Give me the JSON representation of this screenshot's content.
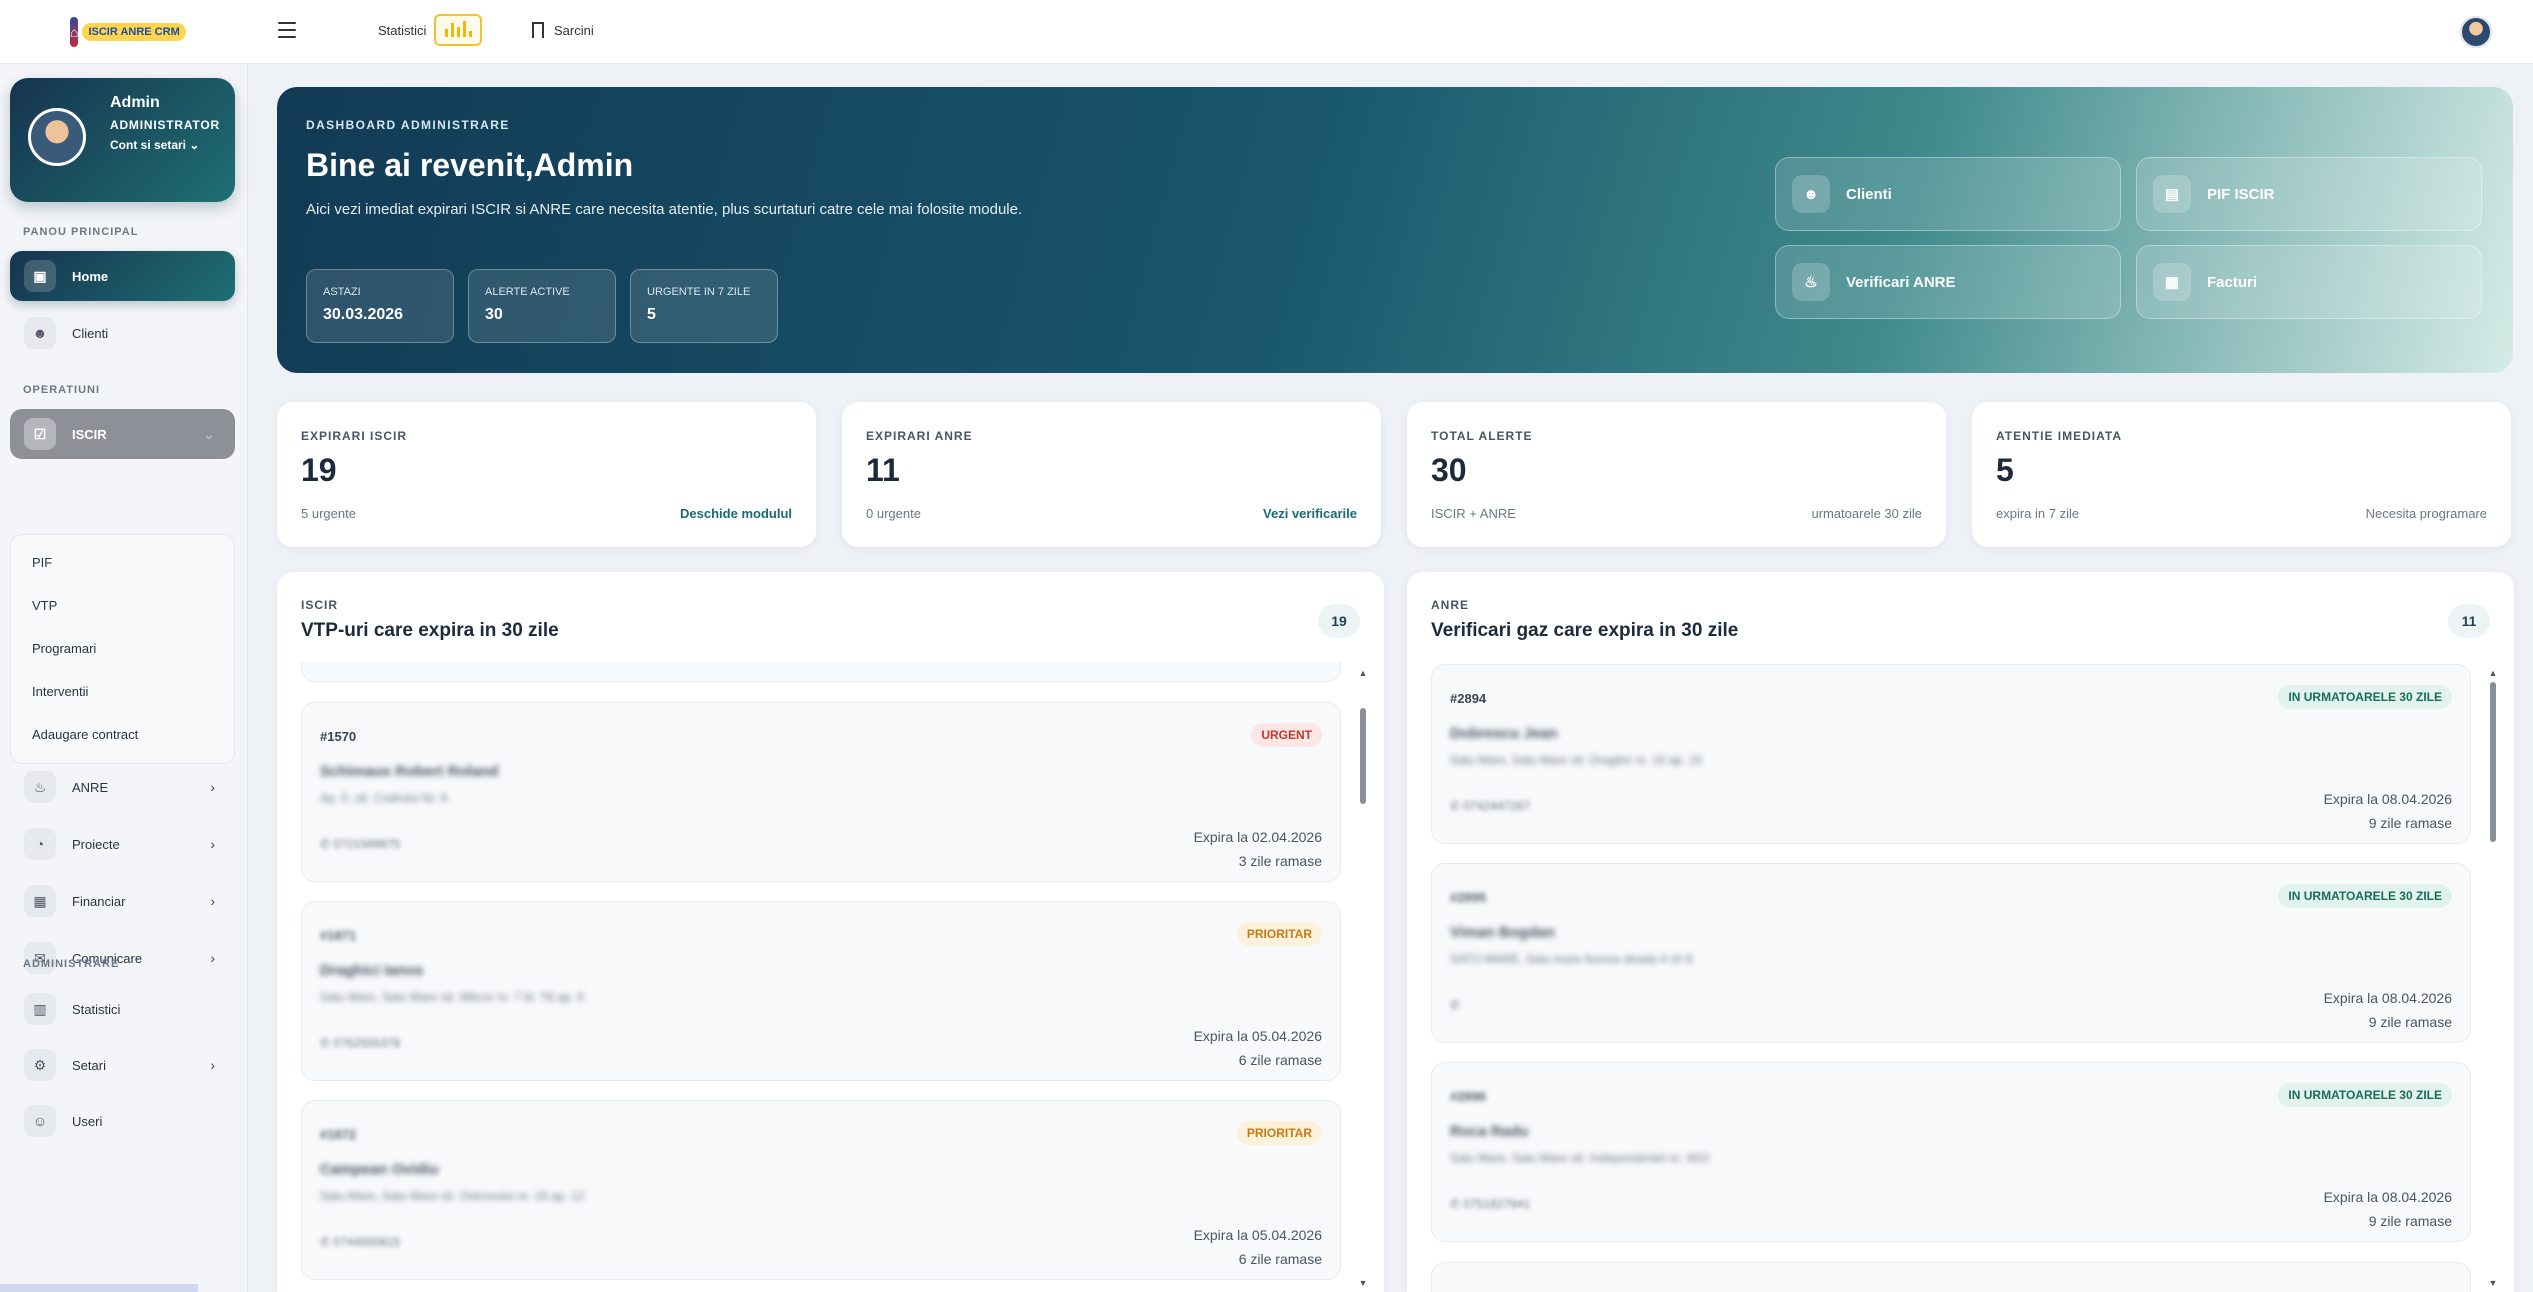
{
  "topbar": {
    "logo_text": "ISCIR ANRE CRM",
    "nav_stats_label": "Statistici",
    "nav_tasks_label": "Sarcini"
  },
  "sidebar": {
    "profile": {
      "name": "Admin",
      "role": "ADMINISTRATOR",
      "account": "Cont si setari ⌄"
    },
    "section_main": "PANOU PRINCIPAL",
    "home": "Home",
    "clients": "Clienti",
    "section_ops": "OPERATIUNI",
    "iscir": "ISCIR",
    "iscir_sub": [
      "PIF",
      "VTP",
      "Programari",
      "Interventii",
      "Adaugare contract"
    ],
    "anre": "ANRE",
    "projects": "Proiecte",
    "financial": "Financiar",
    "communication": "Comunicare",
    "section_admin": "ADMINISTRARE",
    "stats": "Statistici",
    "settings": "Setari",
    "users": "Useri"
  },
  "hero": {
    "kicker": "DASHBOARD ADMINISTRARE",
    "title": "Bine ai revenit,Admin",
    "description": "Aici vezi imediat expirari ISCIR si ANRE care necesita atentie, plus scurtaturi catre cele mai folosite module.",
    "chips": [
      {
        "label": "ASTAZI",
        "value": "30.03.2026"
      },
      {
        "label": "ALERTE ACTIVE",
        "value": "30"
      },
      {
        "label": "URGENTE IN 7 ZILE",
        "value": "5"
      }
    ],
    "quick_actions": [
      "Clienti",
      "PIF ISCIR",
      "Verificari ANRE",
      "Facturi"
    ]
  },
  "stats": [
    {
      "label": "EXPIRARI ISCIR",
      "value": "19",
      "sub": "5 urgente",
      "right": "Deschide modulul"
    },
    {
      "label": "EXPIRARI ANRE",
      "value": "11",
      "sub": "0 urgente",
      "right": "Vezi verificarile"
    },
    {
      "label": "TOTAL ALERTE",
      "value": "30",
      "sub": "ISCIR + ANRE",
      "right": "urmatoarele 30 zile"
    },
    {
      "label": "ATENTIE IMEDIATA",
      "value": "5",
      "sub": "expira in 7 zile",
      "right": "Necesita programare"
    }
  ],
  "iscir_panel": {
    "kicker": "ISCIR",
    "title": "VTP-uri care expira in 30 zile",
    "count": "19",
    "items": [
      {
        "id": "#1570",
        "name": "Schimaus Robert Roland",
        "address": "Ap. 5, str. Codrului Nr. 6",
        "phone": "0721589875",
        "badge": "URGENT",
        "expiry": "Expira la 02.04.2026",
        "remaining": "3 zile ramase"
      },
      {
        "id": "#1871",
        "name": "Draghici Ianos",
        "address": "Satu Mare, Satu Mare str. Milcov nr. 7 bl. T8 ap. 6",
        "phone": "0762555378",
        "badge": "PRIORITAR",
        "expiry": "Expira la 05.04.2026",
        "remaining": "6 zile ramase"
      },
      {
        "id": "#1872",
        "name": "Campean Ovidiu",
        "address": "Satu Mare, Satu Mare str. Ostrovului nr. 18 ap. 12",
        "phone": "0744000815",
        "badge": "PRIORITAR",
        "expiry": "Expira la 05.04.2026",
        "remaining": "6 zile ramase"
      }
    ]
  },
  "anre_panel": {
    "kicker": "ANRE",
    "title": "Verificari gaz care expira in 30 zile",
    "count": "11",
    "items": [
      {
        "id": "#2894",
        "name": "Dobrescu Jean",
        "address": "Satu Mare, Satu Mare str. Dragilor nr. 16 ap. 15",
        "phone": "0742447287",
        "badge": "IN URMATOARELE 30 ZILE",
        "expiry": "Expira la 08.04.2026",
        "remaining": "9 zile ramase"
      },
      {
        "id": "#2895",
        "name": "Viman Bogdan",
        "address": "SATU MARE, Satu mare Aurora strada 4 ch 8",
        "phone": "",
        "badge": "IN URMATOARELE 30 ZILE",
        "expiry": "Expira la 08.04.2026",
        "remaining": "9 zile ramase"
      },
      {
        "id": "#2896",
        "name": "Roca Radu",
        "address": "Satu Mare, Satu Mare str. Independentei nr. 40/2",
        "phone": "0751827941",
        "badge": "IN URMATOARELE 30 ZILE",
        "expiry": "Expira la 08.04.2026",
        "remaining": "9 zile ramase"
      }
    ]
  },
  "colors": {
    "primary_dark": "#16344f",
    "teal": "#1f6f73",
    "urgent": "#c0392b",
    "priority": "#c77a10",
    "ok": "#1a6b5a"
  },
  "icons": [
    "menu-icon",
    "bar-chart-icon",
    "bookmark-icon",
    "users-icon",
    "file-icon",
    "flame-icon",
    "calculator-icon"
  ]
}
